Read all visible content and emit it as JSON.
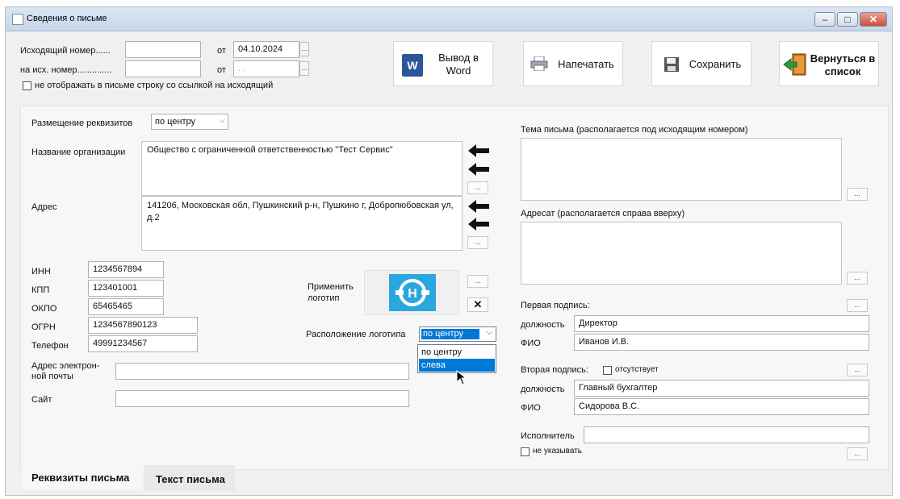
{
  "window": {
    "title": "Сведения о письме",
    "minimize_glyph": "–",
    "maximize_glyph": "□",
    "close_glyph": "✕"
  },
  "top": {
    "outgoing_number_label": "Исходящий номер......",
    "reply_number_label": "на исх. номер..............",
    "from_label_1": "от",
    "from_label_2": "от",
    "outgoing_number_value": "",
    "reply_number_value": "",
    "date_1": "04.10.2024",
    "date_2": " . .",
    "hide_link_checkbox_label": "не отображать в письме строку со ссылкой на исходящий",
    "date_btn_glyph": "..."
  },
  "toolbar": {
    "word_label": "Вывод в Word",
    "print_label": "Напечатать",
    "save_label": "Сохранить",
    "back_label": "Вернуться в список"
  },
  "left": {
    "placement_label": "Размещение реквизитов",
    "placement_value": "по центру",
    "org_name_label": "Название организации",
    "org_name_value": "Общество с ограниченной ответственностью \"Тест Сервис\"",
    "address_label": "Адрес",
    "address_value": "141206, Московская обл, Пушкинский р-н, Пушкино г, Добропюбовская ул, д.2",
    "inn_label": "ИНН",
    "inn_value": "1234567894",
    "kpp_label": "КПП",
    "kpp_value": "123401001",
    "okpo_label": "ОКПО",
    "okpo_value": "65465465",
    "ogrn_label": "ОГРН",
    "ogrn_value": "1234567890123",
    "phone_label": "Телефон",
    "phone_value": "49991234567",
    "email_label": "Адрес электрон-ной почты",
    "email_value": "",
    "site_label": "Сайт",
    "site_value": "",
    "dots": "..."
  },
  "logo": {
    "apply_label": "Применить логотип",
    "position_label": "Расположение логотипа",
    "position_value": "по центру",
    "dropdown_options": [
      "по центру",
      "слева"
    ],
    "highlighted_option": "слева",
    "remove_glyph": "✕",
    "logo_color": "#2aa7df"
  },
  "right": {
    "subject_label": "Тема письма (располагается под исходящим номером)",
    "addressee_label": "Адресат (располагается справа вверху)",
    "first_sign_label": "Первая подпись:",
    "position_label_1": "должность",
    "position_value_1": "Директор",
    "fio_label_1": "ФИО",
    "fio_value_1": "Иванов И.В.",
    "second_sign_label": "Вторая подпись:",
    "absent_label": "отсутствует",
    "position_label_2": "должность",
    "position_value_2": "Главный бухгалтер",
    "fio_label_2": "ФИО",
    "fio_value_2": "Сидорова В.С.",
    "executor_label": "Исполнитель",
    "executor_value": "",
    "not_specify_label": "не указывать"
  },
  "tabs": [
    "Реквизиты письма",
    "Текст письма"
  ],
  "colors": {
    "accent": "#0078d7",
    "arrow": "#111111",
    "word_blue": "#2b579a"
  }
}
